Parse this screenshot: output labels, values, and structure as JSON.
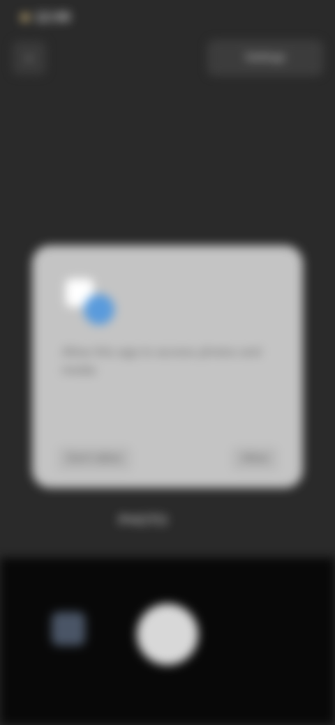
{
  "status_bar": {
    "time": "12:00"
  },
  "top_bar": {
    "back_icon": "back-arrow-icon",
    "pill_label": "Settings"
  },
  "dialog": {
    "icon_name": "cloud-app-icon",
    "title": "Allow this app to access photos and media",
    "body": "",
    "deny_label": "Don't allow",
    "allow_label": "Allow"
  },
  "camera_modes": {
    "main": "PHOTO",
    "side": ""
  },
  "bottom_bar": {
    "thumbnail_icon": "gallery-thumbnail-icon",
    "shutter_icon": "shutter-button-icon"
  }
}
